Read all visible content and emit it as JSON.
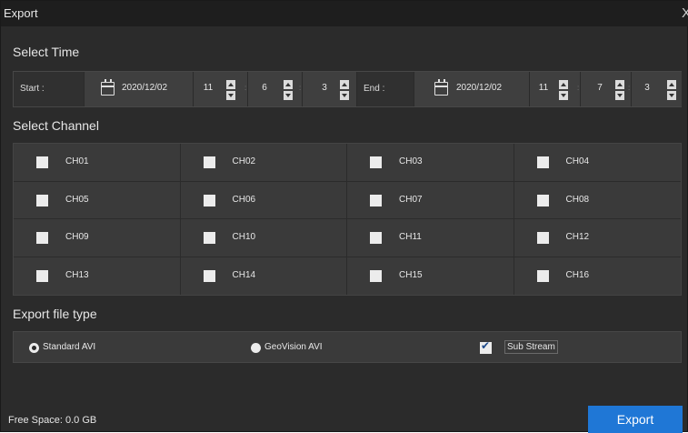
{
  "window": {
    "title": "Export",
    "close_glyph": "X"
  },
  "select_time": {
    "heading": "Select Time",
    "start": {
      "label": "Start :",
      "date": "2020/12/02",
      "hour": "11",
      "minute": "6",
      "second": "3"
    },
    "end": {
      "label": "End :",
      "date": "2020/12/02",
      "hour": "11",
      "minute": "7",
      "second": "3"
    }
  },
  "select_channel": {
    "heading": "Select Channel",
    "channels": [
      "CH01",
      "CH02",
      "CH03",
      "CH04",
      "CH05",
      "CH06",
      "CH07",
      "CH08",
      "CH09",
      "CH10",
      "CH11",
      "CH12",
      "CH13",
      "CH14",
      "CH15",
      "CH16"
    ]
  },
  "export_type": {
    "heading": "Export file type",
    "options": [
      {
        "label": "Standard AVI",
        "selected": true
      },
      {
        "label": "GeoVision AVI",
        "selected": false
      }
    ],
    "sub_stream": {
      "label": "Sub Stream",
      "checked": true
    }
  },
  "footer": {
    "free_space": "Free Space: 0.0 GB",
    "export_label": "Export"
  },
  "colors": {
    "accent": "#1f77d6",
    "background": "#2b2b2b",
    "panel": "#3a3a3a"
  }
}
